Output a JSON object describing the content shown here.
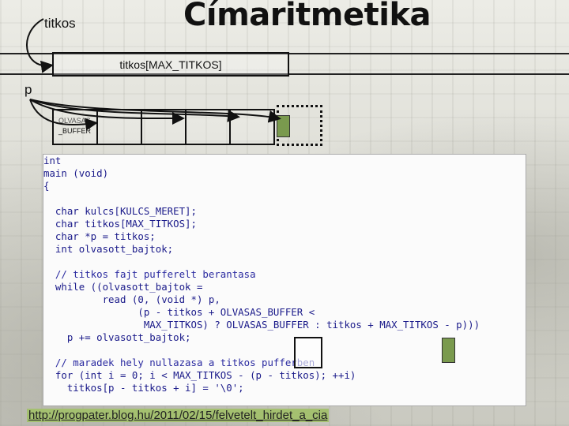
{
  "slide": {
    "title": "Címaritmetika",
    "pointer_label": "titkos",
    "array_label": "titkos[MAX_TITKOS]",
    "p_label": "p",
    "buffer_label_top": "OLVASAS",
    "buffer_label": "_BUFFER",
    "url": "http://progpater.blog.hu/2011/02/15/felvetelt_hirdet_a_cia"
  },
  "colors": {
    "green": "#7a9a4e",
    "code": "#1a1a8a"
  },
  "code": [
    "int",
    "main (void)",
    "{",
    "",
    "  char kulcs[KULCS_MERET];",
    "  char titkos[MAX_TITKOS];",
    "  char *p = titkos;",
    "  int olvasott_bajtok;",
    "",
    "  // titkos fajt pufferelt berantasa",
    "  while ((olvasott_bajtok =",
    "          read (0, (void *) p,",
    "                (p - titkos + OLVASAS_BUFFER <",
    "                 MAX_TITKOS) ? OLVASAS_BUFFER : titkos + MAX_TITKOS - p)))",
    "    p += olvasott_bajtok;",
    "",
    "  // maradek hely nullazasa a titkos pufferben",
    "  for (int i = 0; i < MAX_TITKOS - (p - titkos); ++i)",
    "    titkos[p - titkos + i] = '\\0';"
  ]
}
